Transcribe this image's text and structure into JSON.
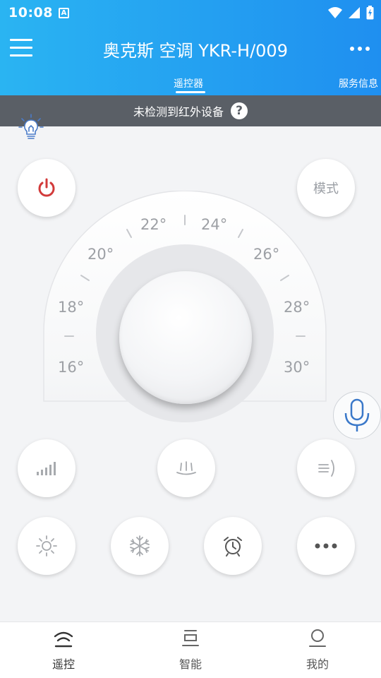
{
  "status": {
    "time": "10:08",
    "notification_badge": "A"
  },
  "header": {
    "title": "奥克斯 空调 YKR-H/009",
    "tabs": [
      {
        "label": "遥控器",
        "active": true
      },
      {
        "label": "服务信息",
        "active": false
      }
    ]
  },
  "warning": {
    "text": "未检测到红外设备",
    "help_label": "?"
  },
  "controls": {
    "mode_label": "模式",
    "power_color": "#d23a3a",
    "temperature_ticks": [
      "16°",
      "18°",
      "20°",
      "22°",
      "24°",
      "26°",
      "28°",
      "30°"
    ]
  },
  "icons": [
    "menu-icon",
    "more-icon",
    "bulb-icon",
    "power-icon",
    "mic-icon",
    "fan-speed-icon",
    "swing-down-icon",
    "swing-side-icon",
    "sun-icon",
    "snowflake-icon",
    "alarm-icon",
    "more-dots-icon",
    "remote-icon",
    "smart-icon",
    "user-icon"
  ],
  "accent_color": "#1f8ff0",
  "bottom_nav": [
    {
      "label": "遥控"
    },
    {
      "label": "智能"
    },
    {
      "label": "我的"
    }
  ]
}
